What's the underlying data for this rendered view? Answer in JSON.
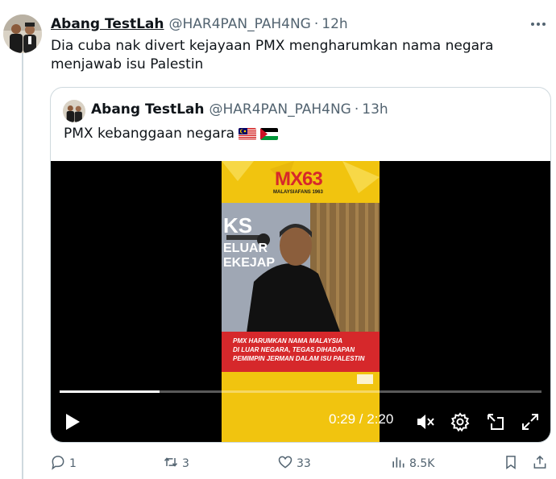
{
  "tweet": {
    "author_name": "Abang TestLah",
    "handle": "@HAR4PAN_PAH4NG",
    "separator": "·",
    "time": "12h",
    "text": "Dia cuba nak divert kejayaan PMX mengharumkan nama negara menjawab isu Palestin",
    "more_icon": "more-horizontal-icon"
  },
  "quote": {
    "author_name": "Abang TestLah",
    "handle": "@HAR4PAN_PAH4NG",
    "separator": "·",
    "time": "13h",
    "text": "PMX kebanggaan negara",
    "flags": [
      "malaysia-flag-icon",
      "palestine-flag-icon"
    ]
  },
  "video": {
    "current_time": "0:29",
    "duration": "2:20",
    "time_display": "0:29 / 2:20",
    "progress_fraction": 0.207,
    "logo_text": "MALAYSIAFANS 1963",
    "caption_lines": [
      "PMX HARUMKAN NAMA MALAYSIA",
      "DI LUAR NEGARA, TEGAS DIHADAPAN",
      "PEMIMPIN JERMAN DALAM ISU PALESTIN"
    ],
    "backdrop_text": [
      "KS",
      "ELUAR",
      "EKEJAP"
    ],
    "controls": [
      "play-icon",
      "mute-icon",
      "settings-icon",
      "pip-icon",
      "fullscreen-icon"
    ]
  },
  "actions": {
    "replies": "1",
    "reposts": "3",
    "likes": "33",
    "views": "8.5K"
  },
  "colors": {
    "text_primary": "#0f1419",
    "text_secondary": "#536471",
    "border": "#cfd9de",
    "video_bg": "#000000",
    "frame_yellow": "#f1c40f",
    "caption_red": "#d6282b"
  }
}
